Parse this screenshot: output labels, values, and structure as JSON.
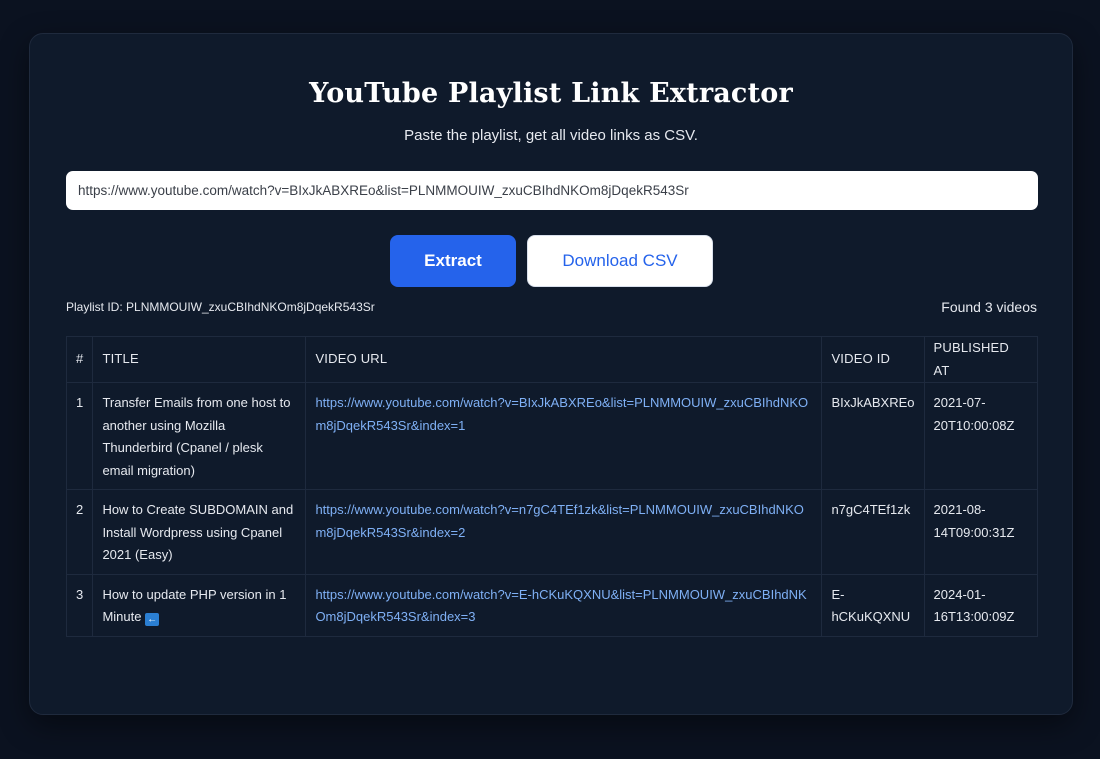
{
  "app": {
    "title": "YouTube Playlist Link Extractor",
    "subtitle": "Paste the playlist, get all video links as CSV."
  },
  "input": {
    "value": "https://www.youtube.com/watch?v=BIxJkABXREo&list=PLNMMOUIW_zxuCBIhdNKOm8jDqekR543Sr",
    "placeholder": ""
  },
  "buttons": {
    "extract_label": "Extract",
    "download_label": "Download CSV"
  },
  "status": {
    "playlist_id": "Playlist ID: PLNMMOUIW_zxuCBIhdNKOm8jDqekR543Sr",
    "found": "Found 3 videos"
  },
  "table": {
    "headers": [
      "#",
      "TITLE",
      "VIDEO URL",
      "VIDEO ID",
      "PUBLISHED AT"
    ],
    "rows": [
      {
        "num": "1",
        "title": "Transfer Emails from one host to another using Mozilla Thunderbird (Cpanel / plesk email migration)",
        "url": "https://www.youtube.com/watch?v=BIxJkABXREo&list=PLNMMOUIW_zxuCBIhdNKOm8jDqekR543Sr&index=1",
        "video_id": "BIxJkABXREo",
        "published": "2021-07-20T10:00:08Z"
      },
      {
        "num": "2",
        "title": "How to Create SUBDOMAIN and Install Wordpress using Cpanel 2021 (Easy)",
        "url": "https://www.youtube.com/watch?v=n7gC4TEf1zk&list=PLNMMOUIW_zxuCBIhdNKOm8jDqekR543Sr&index=2",
        "video_id": "n7gC4TEf1zk",
        "published": "2021-08-14T09:00:31Z"
      },
      {
        "num": "3",
        "title": "How to update PHP version in 1 Minute",
        "title_icon": "left-arrow-emoji-icon",
        "url": "https://www.youtube.com/watch?v=E-hCKuKQXNU&list=PLNMMOUIW_zxuCBIhdNKOm8jDqekR543Sr&index=3",
        "video_id": "E-hCKuKQXNU",
        "published": "2024-01-16T13:00:09Z"
      }
    ]
  },
  "colors": {
    "background": "#0b1220",
    "card": "#0f1a2b",
    "accent": "#2563eb",
    "link": "#7fb0f5"
  }
}
